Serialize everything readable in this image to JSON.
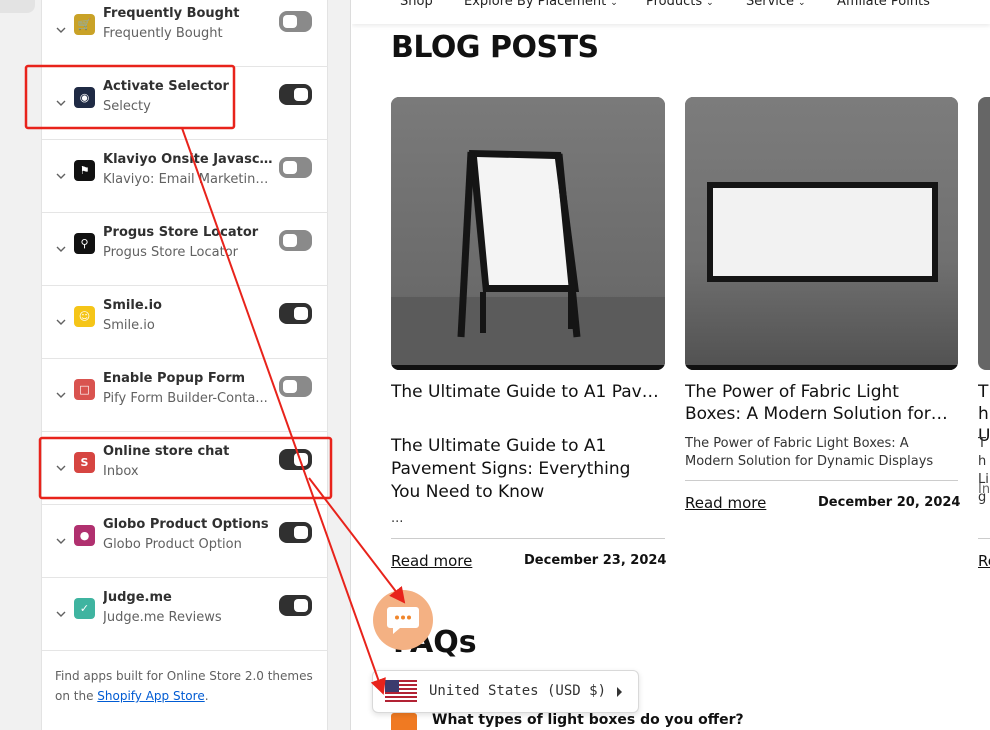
{
  "app_embeds": [
    {
      "title": "Frequently Bought",
      "subtitle": "Frequently Bought",
      "enabled": false,
      "icon": "shopping-cart-icon",
      "color": "#c9a227"
    },
    {
      "title": "Activate Selector",
      "subtitle": "Selecty",
      "enabled": true,
      "icon": "globe-selector-icon",
      "color": "#1f2a44"
    },
    {
      "title": "Klaviyo Onsite Javascript",
      "subtitle": "Klaviyo: Email Marketing...",
      "enabled": false,
      "icon": "klaviyo-flag-icon",
      "color": "#111111"
    },
    {
      "title": "Progus Store Locator",
      "subtitle": "Progus Store Locator",
      "enabled": false,
      "icon": "map-pin-icon",
      "color": "#111111"
    },
    {
      "title": "Smile.io",
      "subtitle": "Smile.io",
      "enabled": true,
      "icon": "smile-icon",
      "color": "#f5c518"
    },
    {
      "title": "Enable Popup Form",
      "subtitle": "Pify Form Builder-Conta...",
      "enabled": false,
      "icon": "popup-form-icon",
      "color": "#d9534f"
    },
    {
      "title": "Online store chat",
      "subtitle": "Inbox",
      "enabled": true,
      "icon": "inbox-s-icon",
      "color": "#d64541"
    },
    {
      "title": "Globo Product Options",
      "subtitle": "Globo Product Option",
      "enabled": true,
      "icon": "globo-icon",
      "color": "#b0306f"
    },
    {
      "title": "Judge.me",
      "subtitle": "Judge.me Reviews",
      "enabled": true,
      "icon": "checkmark-icon",
      "color": "#3fb4a0"
    }
  ],
  "panel_footer": {
    "text": "Find apps built for Online Store 2.0 themes on the ",
    "link": "Shopify App Store",
    "end": "."
  },
  "nav": {
    "items": [
      {
        "label": "Shop",
        "dropdown": false
      },
      {
        "label": "Explore By Placement",
        "dropdown": true
      },
      {
        "label": "Products",
        "dropdown": true
      },
      {
        "label": "Service",
        "dropdown": true
      },
      {
        "label": "Affiliate Points",
        "dropdown": false
      }
    ]
  },
  "blog": {
    "heading": "BLOG POSTS",
    "posts": [
      {
        "title_short": "The Ultimate Guide to A1 Pavement Signs: Everything You...",
        "title_full": "The Ultimate Guide to A1 Pavement Signs: Everything You Need to Know",
        "excerpt": "...",
        "read_more": "Read more",
        "date": "December 23, 2024"
      },
      {
        "title_short": "The Power of Fabric Light Boxes: A Modern Solution for Dynamic...",
        "excerpt": "The Power of Fabric Light Boxes: A Modern Solution for Dynamic Displays",
        "read_more": "Read more",
        "date": "December 20, 2024"
      },
      {
        "title_fragment": "Th U",
        "excerpt_fragment": "Th Lig",
        "excerpt_end": "In",
        "read_more": "Re"
      }
    ]
  },
  "faq": {
    "heading": "FAQs",
    "first_question": "What types of light boxes do you offer?"
  },
  "currency_selector": {
    "label": "United States (USD $)"
  }
}
